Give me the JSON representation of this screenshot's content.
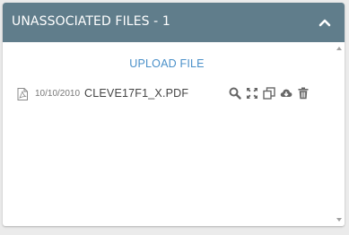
{
  "panel": {
    "title": "UNASSOCIATED FILES - 1",
    "collapse_icon": "chevron-up-icon",
    "header_color": "#607d8b"
  },
  "upload": {
    "label": "UPLOAD FILE",
    "color": "#4a90c9"
  },
  "files": [
    {
      "icon": "pdf-file-icon",
      "date": "10/10/2010",
      "name": "CLEVE17F1_X.PDF",
      "actions": [
        "search-icon",
        "expand-icon",
        "copy-icon",
        "cloud-download-icon",
        "trash-icon"
      ]
    }
  ]
}
